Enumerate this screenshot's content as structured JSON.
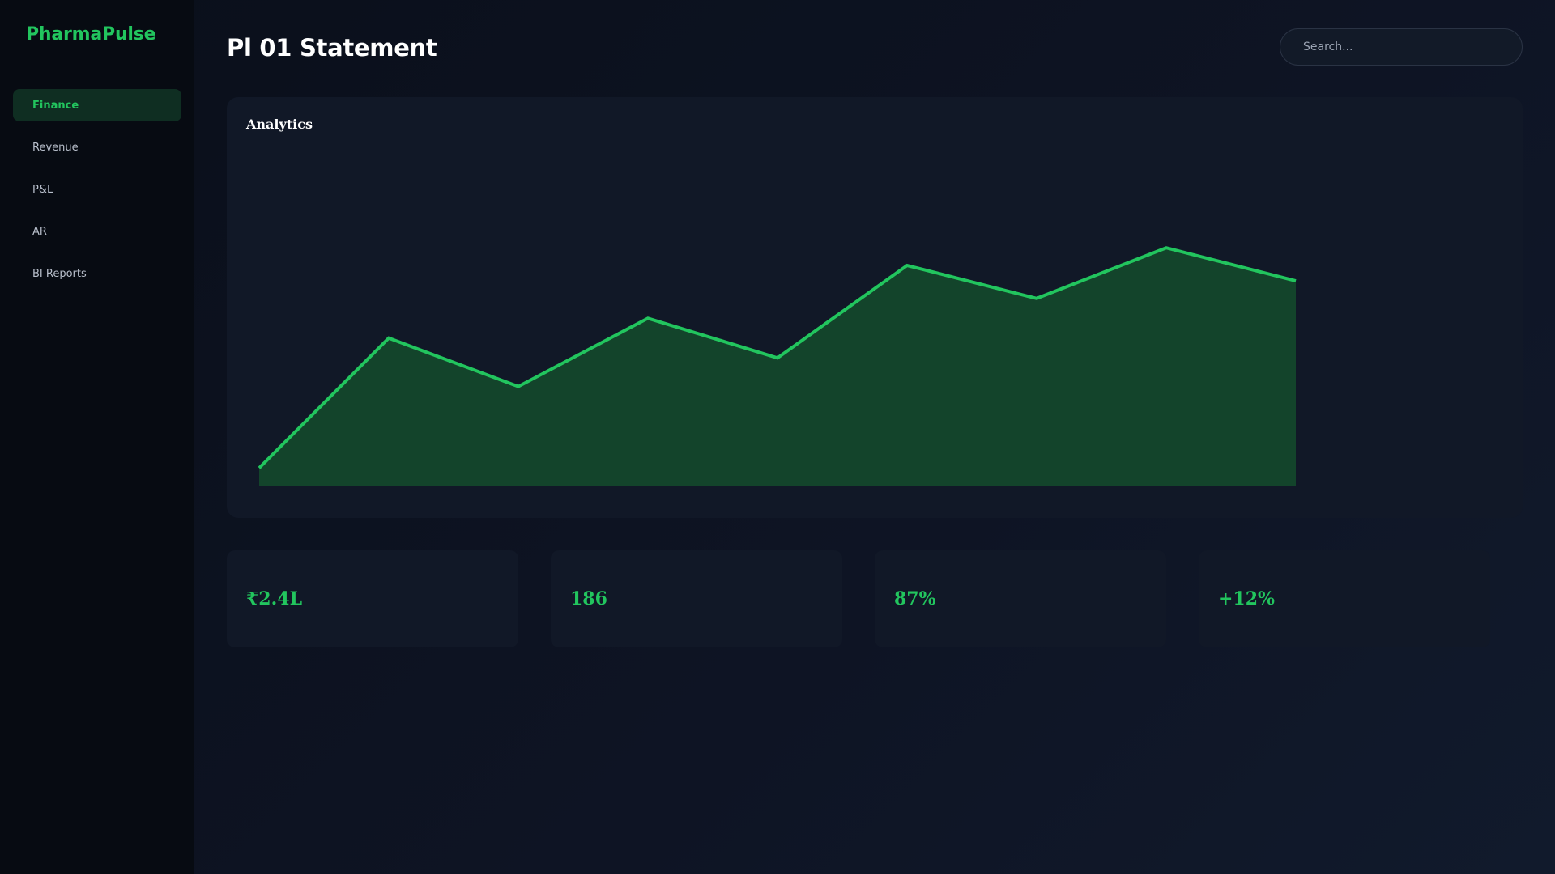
{
  "app": {
    "brand": "PharmaPulse"
  },
  "sidebar": {
    "items": [
      {
        "label": "Finance",
        "active": true
      },
      {
        "label": "Revenue",
        "active": false
      },
      {
        "label": "P&L",
        "active": false
      },
      {
        "label": "AR",
        "active": false
      },
      {
        "label": "BI Reports",
        "active": false
      }
    ]
  },
  "header": {
    "title": "Pl 01 Statement",
    "search_placeholder": "Search..."
  },
  "chart_card": {
    "title": "Analytics"
  },
  "chart_data": {
    "type": "area",
    "title": "Analytics",
    "x": [
      1,
      2,
      3,
      4,
      5,
      6,
      7,
      8,
      9
    ],
    "series": [
      {
        "values": [
          8,
          67,
          45,
          76,
          58,
          100,
          85,
          108,
          93
        ]
      }
    ],
    "ylim": [
      0,
      125
    ],
    "grid": false,
    "legend": "none",
    "color": "#22c55e",
    "fill_color": "#14532d"
  },
  "stats": [
    {
      "value": "₹2.4L"
    },
    {
      "value": "186"
    },
    {
      "value": "87%"
    },
    {
      "value": "+12%"
    }
  ],
  "colors": {
    "accent": "#22c55e",
    "sidebar_bg": "#070b12",
    "card_bg": "#111827",
    "active_nav_bg": "#0f2e22"
  }
}
